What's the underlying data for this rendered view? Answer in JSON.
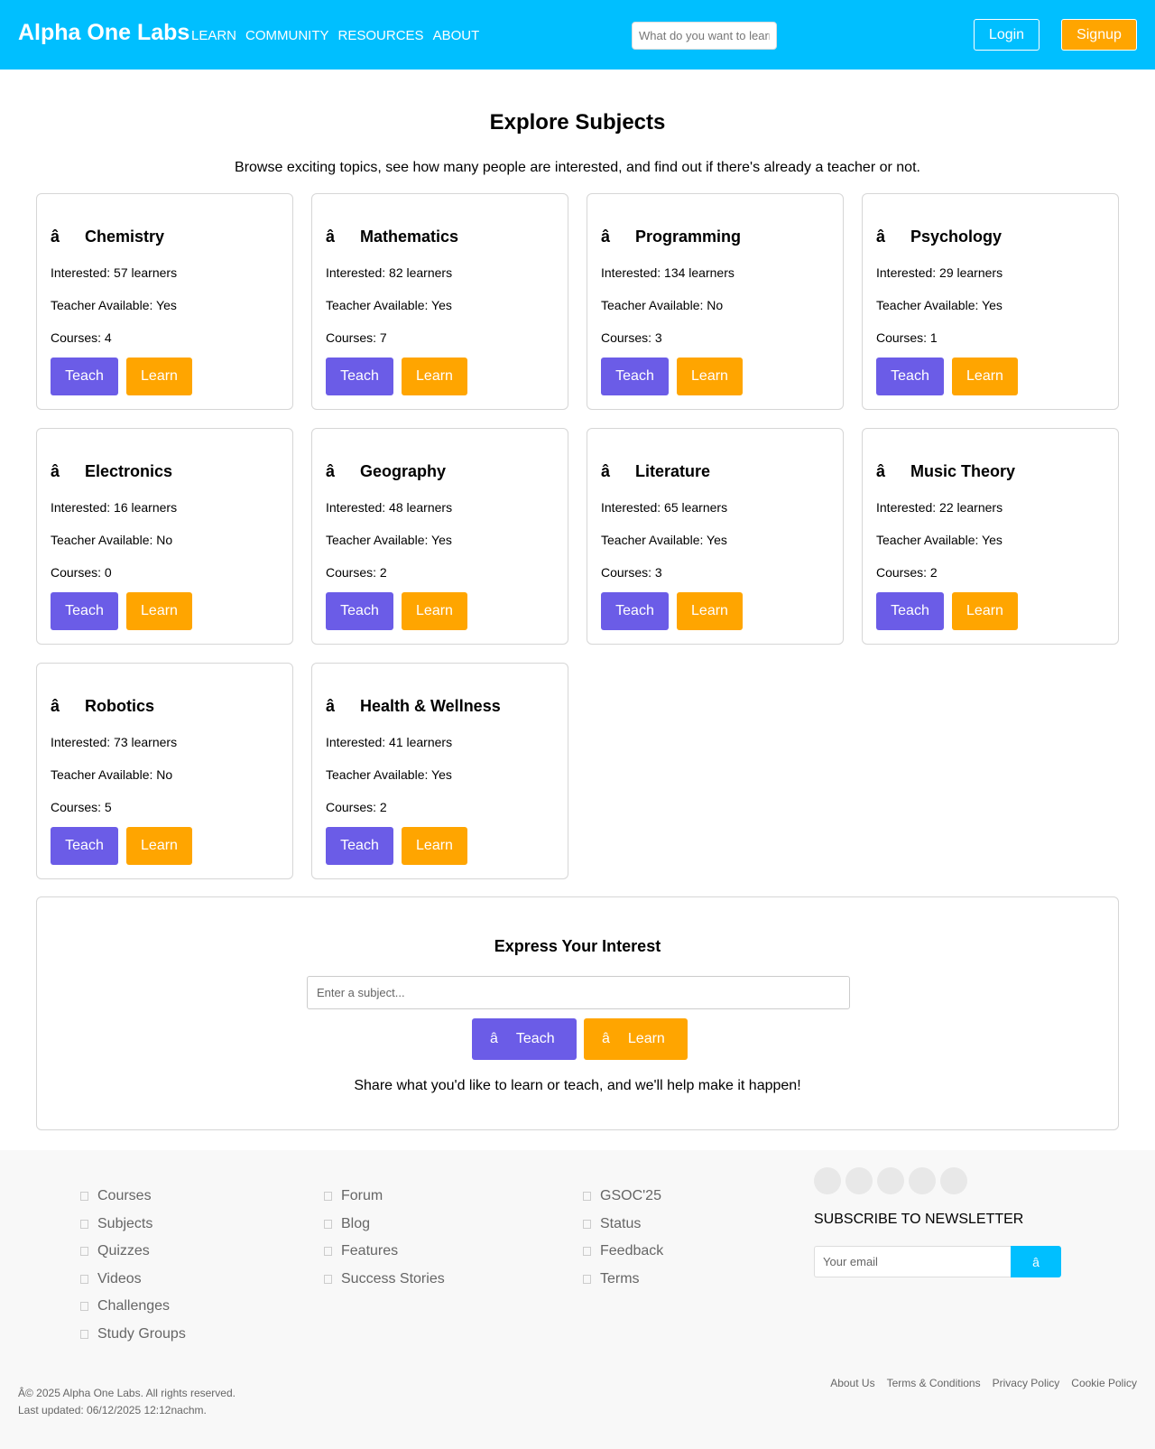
{
  "header": {
    "logo": "Alpha One Labs",
    "nav": [
      "LEARN",
      "COMMUNITY",
      "RESOURCES",
      "ABOUT"
    ],
    "search_placeholder": "What do you want to learn?",
    "login_label": "Login",
    "signup_label": "Signup"
  },
  "main": {
    "title": "Explore Subjects",
    "subtitle": "Browse exciting topics, see how many people are interested, and find out if there's already a teacher or not."
  },
  "subjects": [
    {
      "icon": "â",
      "name": "Chemistry",
      "interested": "Interested: 57 learners",
      "teacher": "Teacher Available: Yes",
      "courses": "Courses: 4",
      "teach": "Teach",
      "learn": "Learn"
    },
    {
      "icon": "â",
      "name": "Mathematics",
      "interested": "Interested: 82 learners",
      "teacher": "Teacher Available: Yes",
      "courses": "Courses: 7",
      "teach": "Teach",
      "learn": "Learn"
    },
    {
      "icon": "â",
      "name": "Programming",
      "interested": "Interested: 134 learners",
      "teacher": "Teacher Available: No",
      "courses": "Courses: 3",
      "teach": "Teach",
      "learn": "Learn"
    },
    {
      "icon": "â",
      "name": "Psychology",
      "interested": "Interested: 29 learners",
      "teacher": "Teacher Available: Yes",
      "courses": "Courses: 1",
      "teach": "Teach",
      "learn": "Learn"
    },
    {
      "icon": "â",
      "name": "Electronics",
      "interested": "Interested: 16 learners",
      "teacher": "Teacher Available: No",
      "courses": "Courses: 0",
      "teach": "Teach",
      "learn": "Learn"
    },
    {
      "icon": "â",
      "name": "Geography",
      "interested": "Interested: 48 learners",
      "teacher": "Teacher Available: Yes",
      "courses": "Courses: 2",
      "teach": "Teach",
      "learn": "Learn"
    },
    {
      "icon": "â",
      "name": "Literature",
      "interested": "Interested: 65 learners",
      "teacher": "Teacher Available: Yes",
      "courses": "Courses: 3",
      "teach": "Teach",
      "learn": "Learn"
    },
    {
      "icon": "â",
      "name": "Music Theory",
      "interested": "Interested: 22 learners",
      "teacher": "Teacher Available: Yes",
      "courses": "Courses: 2",
      "teach": "Teach",
      "learn": "Learn"
    },
    {
      "icon": "â",
      "name": "Robotics",
      "interested": "Interested: 73 learners",
      "teacher": "Teacher Available: No",
      "courses": "Courses: 5",
      "teach": "Teach",
      "learn": "Learn"
    },
    {
      "icon": "â",
      "name": "Health & Wellness",
      "interested": "Interested: 41 learners",
      "teacher": "Teacher Available: Yes",
      "courses": "Courses: 2",
      "teach": "Teach",
      "learn": "Learn"
    }
  ],
  "interest": {
    "title": "Express Your Interest",
    "placeholder": "Enter a subject...",
    "teach_icon": "â",
    "teach_label": "Teach",
    "learn_icon": "â",
    "learn_label": "Learn",
    "note": "Share what you'd like to learn or teach, and we'll help make it happen!"
  },
  "footer": {
    "col1": [
      "Courses",
      "Subjects",
      "Quizzes",
      "Videos",
      "Challenges",
      "Study Groups"
    ],
    "col2": [
      "Forum",
      "Blog",
      "Features",
      "Success Stories"
    ],
    "col3": [
      "GSOC'25",
      "Status",
      "Feedback",
      "Terms"
    ],
    "newsletter_title": "SUBSCRIBE TO NEWSLETTER",
    "email_placeholder": "Your email",
    "submit_icon": "â",
    "copyright": "Â© 2025 Alpha One Labs. All rights reserved.",
    "last_updated": "Last updated: 06/12/2025 12:12nachm.",
    "legal": [
      "About Us",
      "Terms & Conditions",
      "Privacy Policy",
      "Cookie Policy"
    ]
  },
  "colors": {
    "header_bg": "#00bfff",
    "teach_button": "#6b5ce7",
    "learn_button": "#ffa500",
    "footer_bg": "#f8f8f8"
  }
}
